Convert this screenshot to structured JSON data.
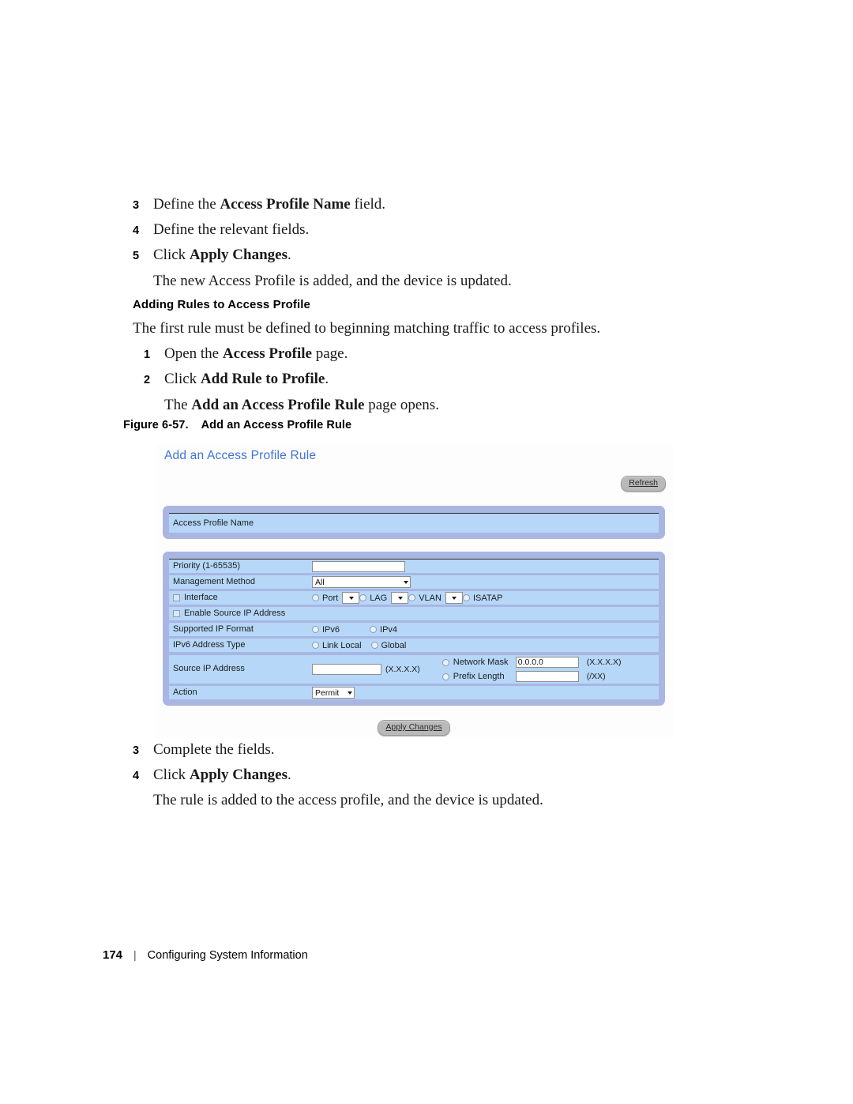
{
  "document": {
    "steps_top": [
      {
        "num": "3",
        "text_before": "Define the ",
        "bold": "Access Profile Name",
        "text_after": " field."
      },
      {
        "num": "4",
        "text_before": "Define the relevant fields.",
        "bold": "",
        "text_after": ""
      },
      {
        "num": "5",
        "text_before": "Click ",
        "bold": "Apply Changes",
        "text_after": "."
      }
    ],
    "step3_full": "Define the Access Profile Name field.",
    "step4_full": "Define the relevant fields.",
    "step5_full": "Click Apply Changes.",
    "result_top": "The new Access Profile is added, and the device is updated.",
    "subheading": "Adding Rules to Access Profile",
    "intro": "The first rule must be defined to beginning matching traffic to access profiles.",
    "step1_full": "Open the Access Profile page.",
    "step2_full": "Click Add Rule to Profile.",
    "result_mid": "The Add an Access Profile Rule page opens.",
    "numbers": {
      "n1": "1",
      "n2": "2",
      "n3": "3",
      "n4": "4",
      "n5": "5"
    },
    "figure": {
      "label": "Figure 6-57.",
      "title": "Add an Access Profile Rule"
    },
    "steps_bottom": {
      "step3": "Complete the fields.",
      "step4": "Click Apply Changes.",
      "result": "The rule is added to the access profile, and the device is updated."
    },
    "footer": {
      "page_number": "174",
      "separator": "|",
      "section": "Configuring System Information"
    }
  },
  "app": {
    "title": "Add an Access Profile Rule",
    "refresh_label": "Refresh",
    "apply_label": "Apply Changes",
    "name_panel": {
      "label": "Access Profile Name"
    },
    "fields": {
      "priority": {
        "label": "Priority (1-65535)",
        "value": "",
        "placeholder": ""
      },
      "management_method": {
        "label": "Management Method",
        "selected": "All",
        "options": [
          "All"
        ]
      },
      "interface": {
        "label": "Interface",
        "checked": false,
        "options": [
          {
            "label": "Port",
            "has_select": true,
            "selected": ""
          },
          {
            "label": "LAG",
            "has_select": true,
            "selected": ""
          },
          {
            "label": "VLAN",
            "has_select": true,
            "selected": ""
          },
          {
            "label": "ISATAP",
            "has_select": false,
            "selected": ""
          }
        ]
      },
      "enable_source_ip": {
        "label": "Enable Source IP Address",
        "checked": false
      },
      "supported_ip_format": {
        "label": "Supported IP Format",
        "options": [
          "IPv6",
          "IPv4"
        ],
        "selected": ""
      },
      "ipv6_address_type": {
        "label": "IPv6 Address Type",
        "options": [
          "Link Local",
          "Global"
        ],
        "selected": ""
      },
      "source_ip_address": {
        "label": "Source IP Address",
        "value": "",
        "format_hint": "(X.X.X.X)",
        "network_mask": {
          "label": "Network Mask",
          "value": "0.0.0.0",
          "format_hint": "(X.X.X.X)"
        },
        "prefix_length": {
          "label": "Prefix Length",
          "value": "",
          "format_hint": "(/XX)"
        }
      },
      "action": {
        "label": "Action",
        "selected": "Permit",
        "options": [
          "Permit"
        ]
      }
    }
  },
  "colors": {
    "link_blue": "#3f73d8",
    "panel_outer": "#a9b6e2",
    "panel_row": "#b6d7f8",
    "button_gray": "#b9b9b9"
  }
}
